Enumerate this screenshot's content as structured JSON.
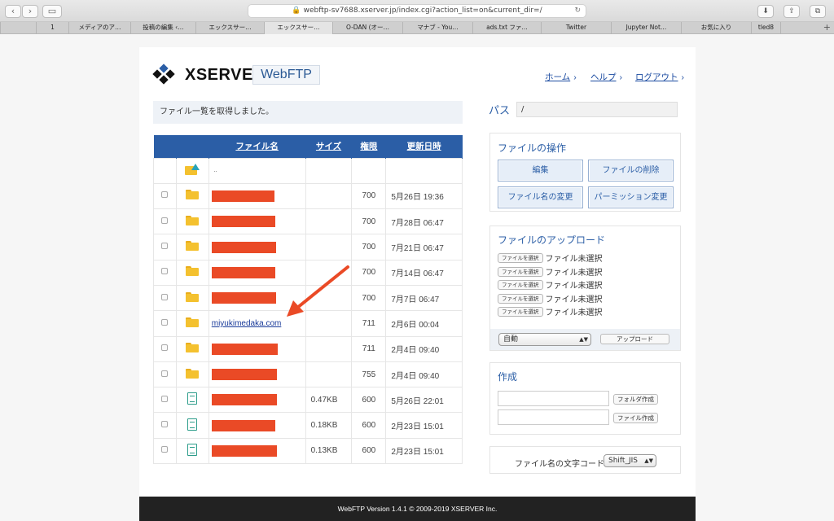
{
  "browser": {
    "url": "webftp-sv7688.xserver.jp/index.cgi?action_list=on&current_dir=/",
    "tabs": [
      "1",
      "メディアのア…",
      "投稿の編集 ‹…",
      "エックスサー…",
      "エックスサー…",
      "O-DAN (オー…",
      "マナブ - You…",
      "ads.txt ファ…",
      "Twitter",
      "Jupyter Not…",
      "お気に入り",
      "tled8",
      ""
    ]
  },
  "header": {
    "logo": "XSERVER",
    "product": "WebFTP",
    "nav": {
      "home": "ホーム",
      "help": "ヘルプ",
      "logout": "ログアウト"
    }
  },
  "status_message": "ファイル一覧を取得しました。",
  "table": {
    "headers": {
      "name": "ファイル名",
      "size": "サイズ",
      "perm": "権限",
      "date": "更新日時"
    },
    "parent_label": "..",
    "rows": [
      {
        "type": "folder",
        "name": "",
        "size": "",
        "perm": "700",
        "date": "5月26日 19:36"
      },
      {
        "type": "folder",
        "name": "",
        "size": "",
        "perm": "700",
        "date": "7月28日 06:47"
      },
      {
        "type": "folder",
        "name": "",
        "size": "",
        "perm": "700",
        "date": "7月21日 06:47"
      },
      {
        "type": "folder",
        "name": "",
        "size": "",
        "perm": "700",
        "date": "7月14日 06:47"
      },
      {
        "type": "folder",
        "name": "",
        "size": "",
        "perm": "700",
        "date": "7月7日 06:47"
      },
      {
        "type": "folder",
        "name": "miyukimedaka.com",
        "size": "",
        "perm": "711",
        "date": "2月6日 00:04"
      },
      {
        "type": "folder",
        "name": "",
        "size": "",
        "perm": "711",
        "date": "2月4日 09:40"
      },
      {
        "type": "folder",
        "name": "",
        "size": "",
        "perm": "755",
        "date": "2月4日 09:40"
      },
      {
        "type": "file",
        "name": "",
        "size": "0.47KB",
        "perm": "600",
        "date": "5月26日 22:01"
      },
      {
        "type": "file",
        "name": "",
        "size": "0.18KB",
        "perm": "600",
        "date": "2月23日 15:01"
      },
      {
        "type": "file",
        "name": "",
        "size": "0.13KB",
        "perm": "600",
        "date": "2月23日 15:01"
      }
    ]
  },
  "path": {
    "label": "パス",
    "value": "/"
  },
  "operations": {
    "title": "ファイルの操作",
    "edit": "編集",
    "delete": "ファイルの削除",
    "rename": "ファイル名の変更",
    "permission": "パーミッション変更"
  },
  "upload": {
    "title": "ファイルのアップロード",
    "choose": "ファイルを選択",
    "none": "ファイル未選択",
    "mode": "自動",
    "button": "アップロード"
  },
  "create": {
    "title": "作成",
    "folder_button": "フォルダ作成",
    "file_button": "ファイル作成"
  },
  "encoding": {
    "label": "ファイル名の文字コード:",
    "value": "Shift_JIS"
  },
  "footer": "WebFTP Version 1.4.1 © 2009-2019 XSERVER Inc.",
  "colors": {
    "primary": "#2b5ea6",
    "redaction": "#ea4a26",
    "folder": "#f4c12f"
  }
}
